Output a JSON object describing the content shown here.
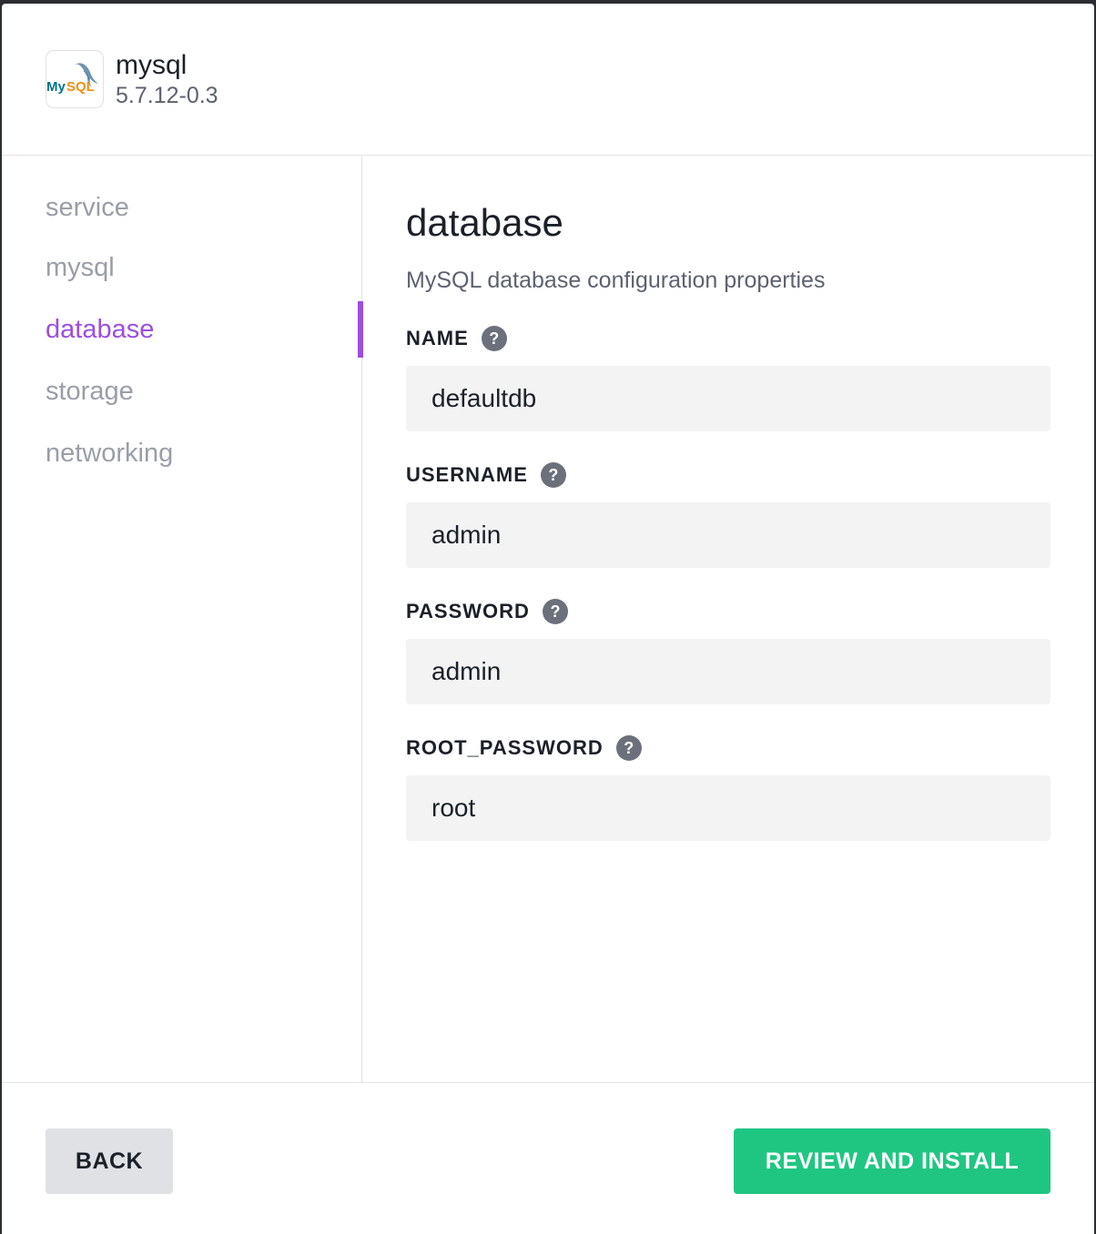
{
  "app": {
    "name": "mysql",
    "version": "5.7.12-0.3",
    "logo_icon": "mysql-logo",
    "logo_text": "MySQL"
  },
  "sidebar": {
    "items": [
      {
        "label": "service",
        "active": false
      },
      {
        "label": "mysql",
        "active": false
      },
      {
        "label": "database",
        "active": true
      },
      {
        "label": "storage",
        "active": false
      },
      {
        "label": "networking",
        "active": false
      }
    ]
  },
  "section": {
    "title": "database",
    "description": "MySQL database configuration properties"
  },
  "fields": [
    {
      "label": "NAME",
      "value": "defaultdb",
      "help_icon": "question-circle-icon",
      "help_glyph": "?"
    },
    {
      "label": "USERNAME",
      "value": "admin",
      "help_icon": "question-circle-icon",
      "help_glyph": "?"
    },
    {
      "label": "PASSWORD",
      "value": "admin",
      "help_icon": "question-circle-icon",
      "help_glyph": "?"
    },
    {
      "label": "ROOT_PASSWORD",
      "value": "root",
      "help_icon": "question-circle-icon",
      "help_glyph": "?"
    }
  ],
  "footer": {
    "back_label": "BACK",
    "install_label": "REVIEW AND INSTALL"
  },
  "colors": {
    "accent": "#9c4ee0",
    "primary_button": "#1fc681",
    "secondary_button": "#e0e1e5",
    "input_bg": "#f3f3f4"
  }
}
